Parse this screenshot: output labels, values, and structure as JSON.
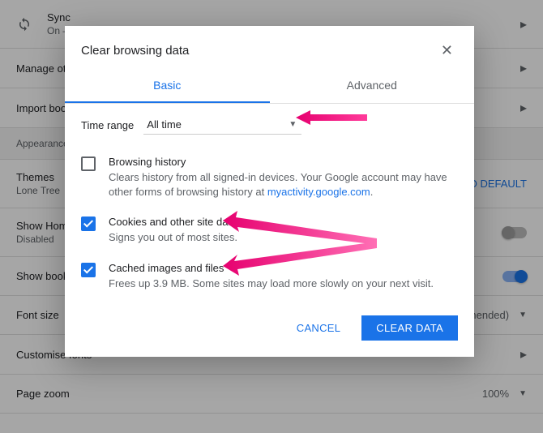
{
  "bg": {
    "sync": {
      "title": "Sync",
      "sub": "On – sync everything"
    },
    "manage": "Manage other people",
    "import": "Import bookmarks and settings",
    "appearance_section": "Appearance",
    "themes": {
      "title": "Themes",
      "sub": "Lone Tree"
    },
    "reset": "RESET TO DEFAULT",
    "show_home": {
      "title": "Show Home button",
      "sub": "Disabled"
    },
    "show_book": "Show bookmarks bar",
    "font_size": {
      "title": "Font size",
      "value": "Medium (recommended)"
    },
    "customise": "Customise fonts",
    "page_zoom": {
      "title": "Page zoom",
      "value": "100%"
    }
  },
  "dialog": {
    "title": "Clear browsing data",
    "tabs": {
      "basic": "Basic",
      "advanced": "Advanced"
    },
    "time_range": {
      "label": "Time range",
      "value": "All time"
    },
    "opt1": {
      "title": "Browsing history",
      "desc_a": "Clears history from all signed-in devices. Your Google account may have other forms of browsing history at ",
      "link": "myactivity.google.com",
      "desc_b": "."
    },
    "opt2": {
      "title": "Cookies and other site data",
      "desc": "Signs you out of most sites."
    },
    "opt3": {
      "title": "Cached images and files",
      "desc": "Frees up 3.9 MB. Some sites may load more slowly on your next visit."
    },
    "cancel": "CANCEL",
    "clear": "CLEAR DATA"
  }
}
